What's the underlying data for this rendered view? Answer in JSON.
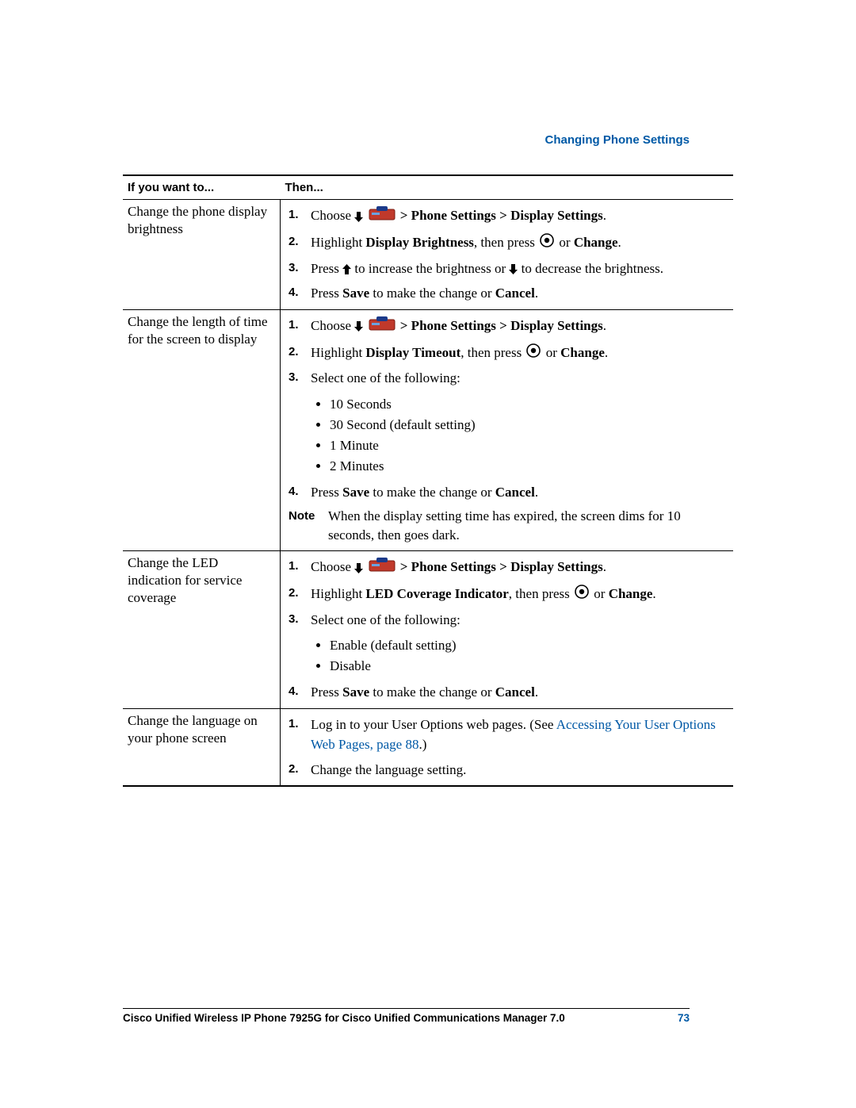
{
  "header": {
    "section_title": "Changing Phone Settings"
  },
  "table": {
    "head": {
      "col1": "If you want to...",
      "col2": "Then..."
    },
    "rows": [
      {
        "task": "Change the phone display brightness",
        "steps": [
          {
            "n": "1.",
            "pre": "Choose ",
            "path": " > Phone Settings > Display Settings",
            "post": "."
          },
          {
            "n": "2.",
            "pre": "Highlight ",
            "bold1": "Display Brightness",
            "mid": ", then press ",
            "tail_or": " or ",
            "bold2": "Change",
            "post": "."
          },
          {
            "n": "3.",
            "pre": "Press ",
            "mid": " to increase the brightness or ",
            "post": " to decrease the brightness."
          },
          {
            "n": "4.",
            "pre": "Press ",
            "bold1": "Save",
            "mid": " to make the change or ",
            "bold2": "Cancel",
            "post": "."
          }
        ]
      },
      {
        "task": "Change the length of time for the screen to display",
        "steps": [
          {
            "n": "1.",
            "pre": "Choose ",
            "path": " > Phone Settings > Display Settings",
            "post": "."
          },
          {
            "n": "2.",
            "pre": "Highlight ",
            "bold1": "Display Timeout",
            "mid": ", then press ",
            "tail_or": " or ",
            "bold2": "Change",
            "post": "."
          },
          {
            "n": "3.",
            "text": "Select one of the following:"
          }
        ],
        "bullets": [
          "10 Seconds",
          "30 Second (default setting)",
          "1 Minute",
          "2 Minutes"
        ],
        "steps_after": [
          {
            "n": "4.",
            "pre": "Press ",
            "bold1": "Save",
            "mid": " to make the change or ",
            "bold2": "Cancel",
            "post": "."
          }
        ],
        "note": {
          "label": "Note",
          "text": "When the display setting time has expired, the screen dims for 10 seconds, then goes dark."
        }
      },
      {
        "task": "Change the LED indication for service coverage",
        "steps": [
          {
            "n": "1.",
            "pre": "Choose ",
            "path": " > Phone Settings > Display Settings",
            "post": "."
          },
          {
            "n": "2.",
            "pre": "Highlight ",
            "bold1": "LED Coverage Indicator",
            "mid": ", then press ",
            "tail_or": " or ",
            "bold2": "Change",
            "post": "."
          },
          {
            "n": "3.",
            "text": "Select one of the following:"
          }
        ],
        "bullets": [
          "Enable (default setting)",
          "Disable"
        ],
        "steps_after": [
          {
            "n": "4.",
            "pre": "Press ",
            "bold1": "Save",
            "mid": " to make the change or ",
            "bold2": "Cancel",
            "post": "."
          }
        ]
      },
      {
        "task": "Change the language on your phone screen",
        "steps": [
          {
            "n": "1.",
            "pre": "Log in to your User Options web pages. (See ",
            "link": "Accessing Your User Options Web Pages, page 88",
            "post": ".)"
          },
          {
            "n": "2.",
            "text": "Change the language setting."
          }
        ]
      }
    ]
  },
  "footer": {
    "title": "Cisco Unified Wireless IP Phone 7925G for Cisco Unified Communications Manager 7.0",
    "page": "73"
  }
}
